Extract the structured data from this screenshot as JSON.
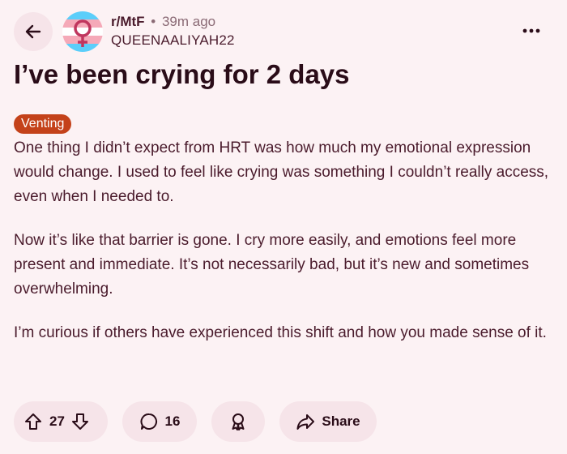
{
  "header": {
    "subreddit": "r/MtF",
    "separator": "•",
    "time_ago": "39m ago",
    "author": "QUEENAALIYAH22",
    "back_icon": "arrow-left-icon",
    "more_icon": "ellipsis-icon",
    "avatar_colors": [
      "#5bcefa",
      "#f5a9b8",
      "#ffffff"
    ]
  },
  "post": {
    "title": "I’ve been crying for 2 days",
    "flair": "Venting",
    "flair_color": "#c4421a",
    "paragraphs": [
      "One thing I didn’t expect from HRT was how much my emotional expression would change. I used to feel like crying was something I couldn’t really access, even when I needed to.",
      "Now it’s like that barrier is gone. I cry more easily, and emotions feel more present and immediate. It’s not necessarily bad, but it’s new and sometimes overwhelming.",
      "I’m curious if others have experienced this shift and how you made sense of it."
    ]
  },
  "actions": {
    "upvote_icon": "upvote-arrow-icon",
    "vote_count": "27",
    "downvote_icon": "downvote-arrow-icon",
    "comment_icon": "comment-bubble-icon",
    "comment_count": "16",
    "award_icon": "award-icon",
    "share_icon": "share-arrow-icon",
    "share_label": "Share"
  }
}
